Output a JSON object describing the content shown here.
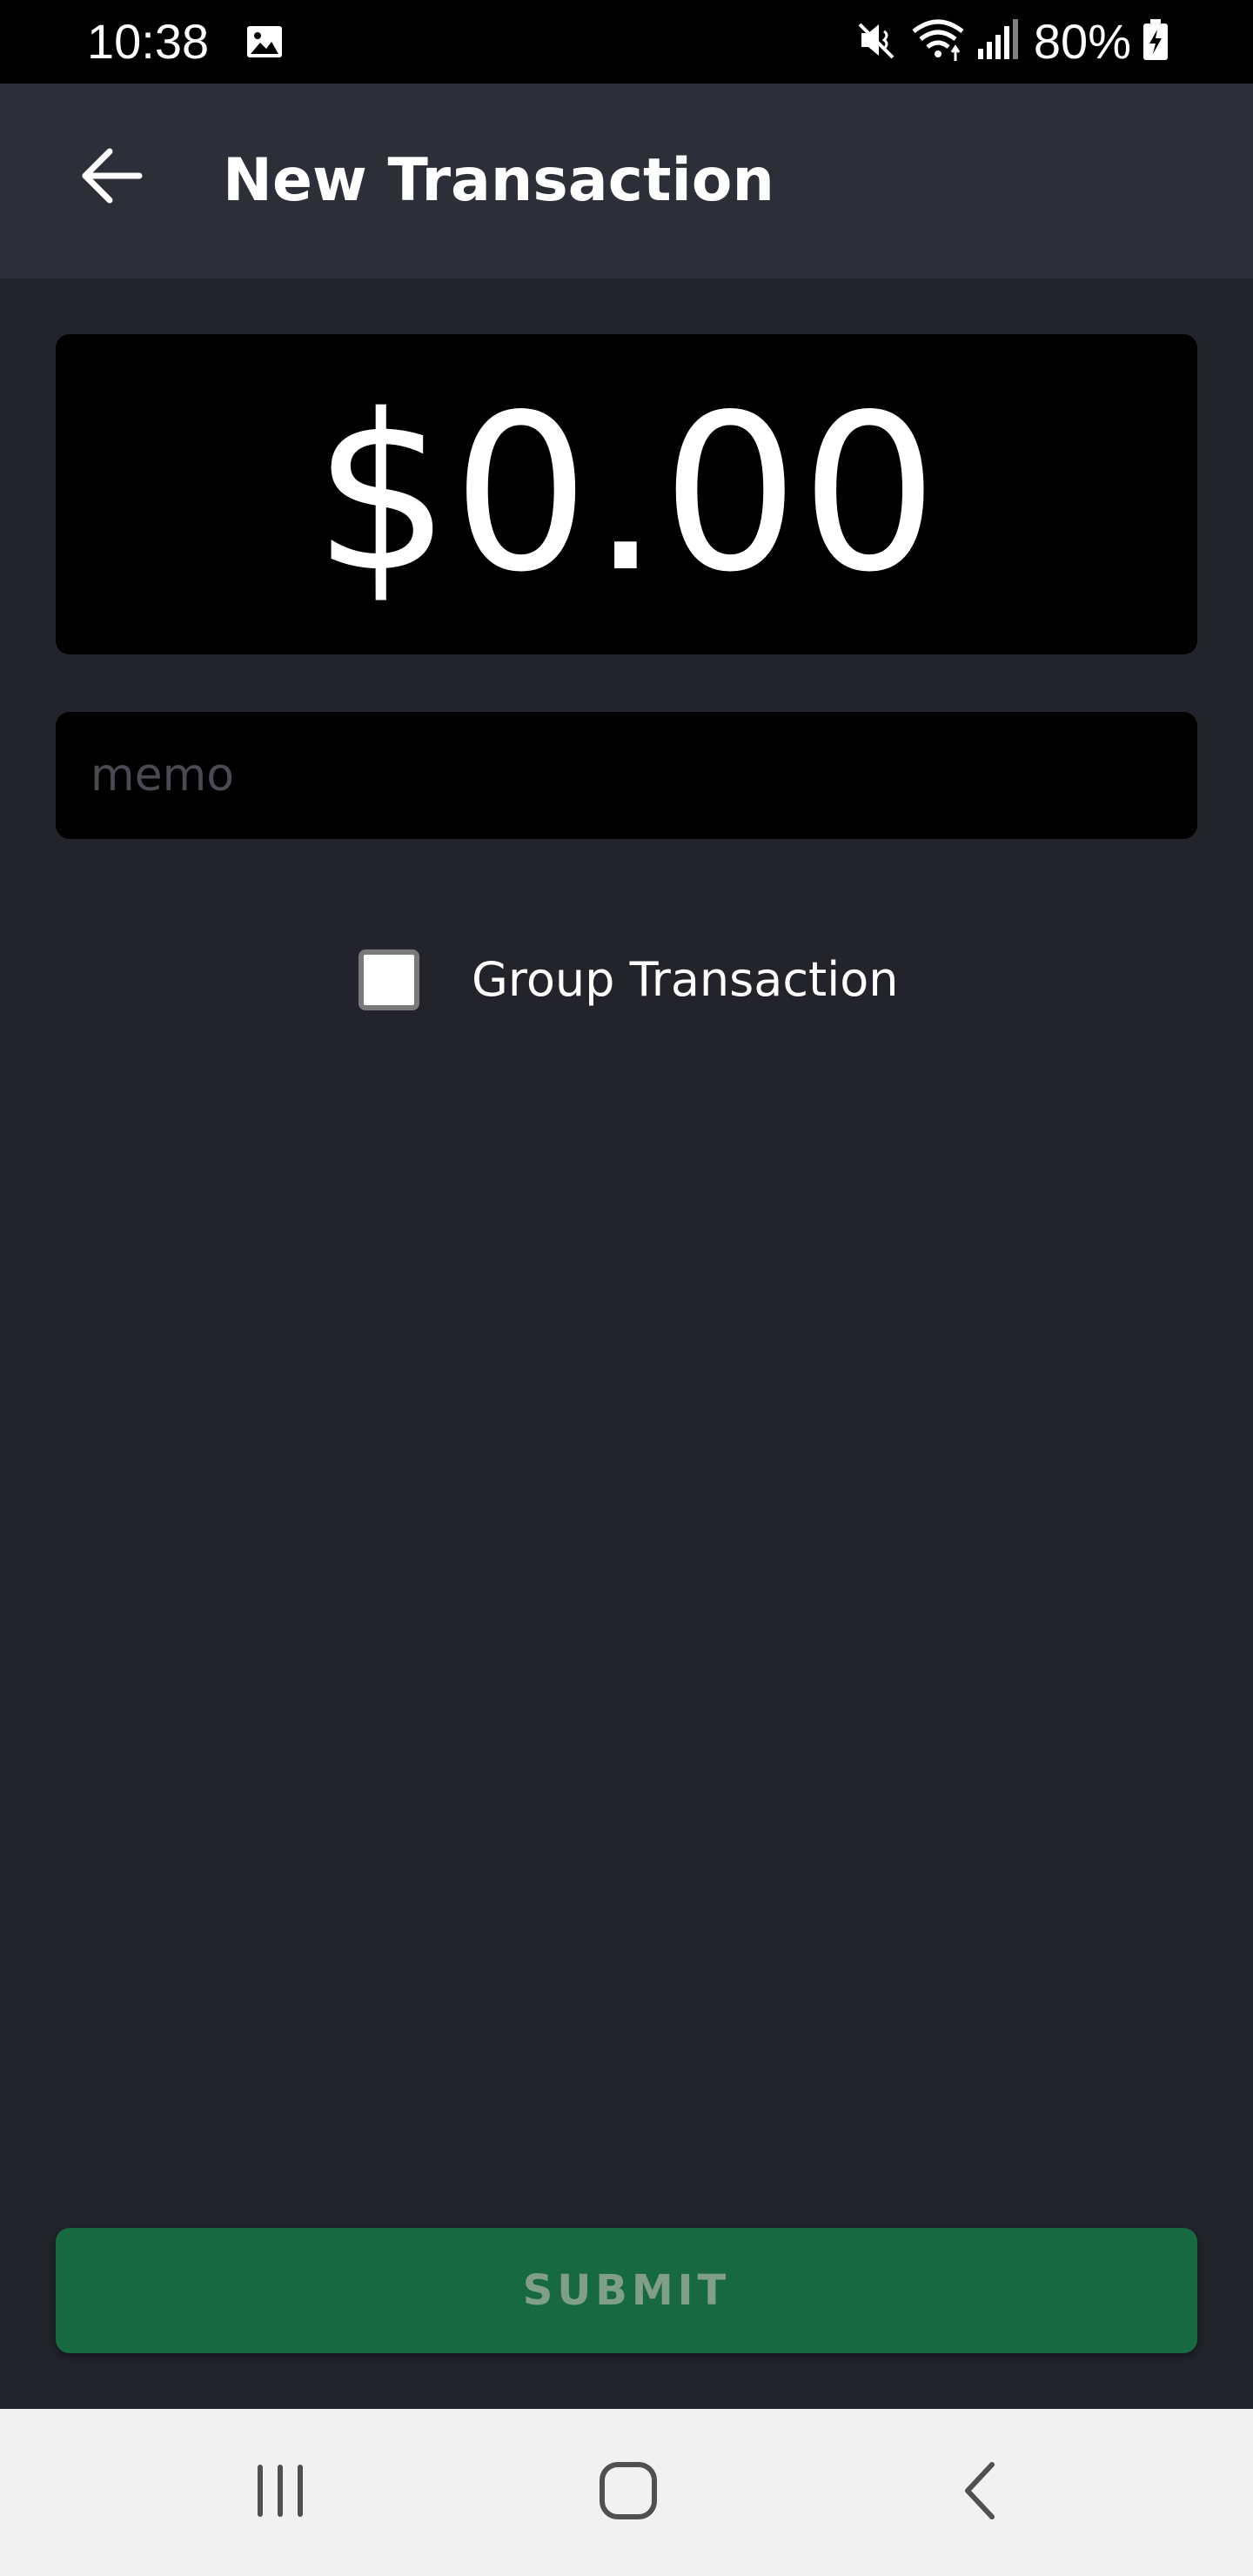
{
  "status_bar": {
    "time": "10:38",
    "battery": "80%",
    "icons": [
      "gallery-icon",
      "mute-icon",
      "wifi-icon",
      "signal-icon",
      "battery-charging-icon"
    ]
  },
  "app_bar": {
    "title": "New Transaction",
    "back_icon": "arrow-left-icon"
  },
  "amount": {
    "value": "$0.00"
  },
  "memo": {
    "placeholder": "memo",
    "value": ""
  },
  "group_transaction": {
    "label": "Group Transaction",
    "checked": false
  },
  "submit": {
    "label": "SUBMIT",
    "color": "#176942"
  },
  "nav_bar": {
    "icons": [
      "recents-icon",
      "home-icon",
      "back-icon"
    ]
  },
  "colors": {
    "background": "#22232b",
    "app_bar": "#2d2f38",
    "field": "#000000",
    "accent": "#176942"
  }
}
